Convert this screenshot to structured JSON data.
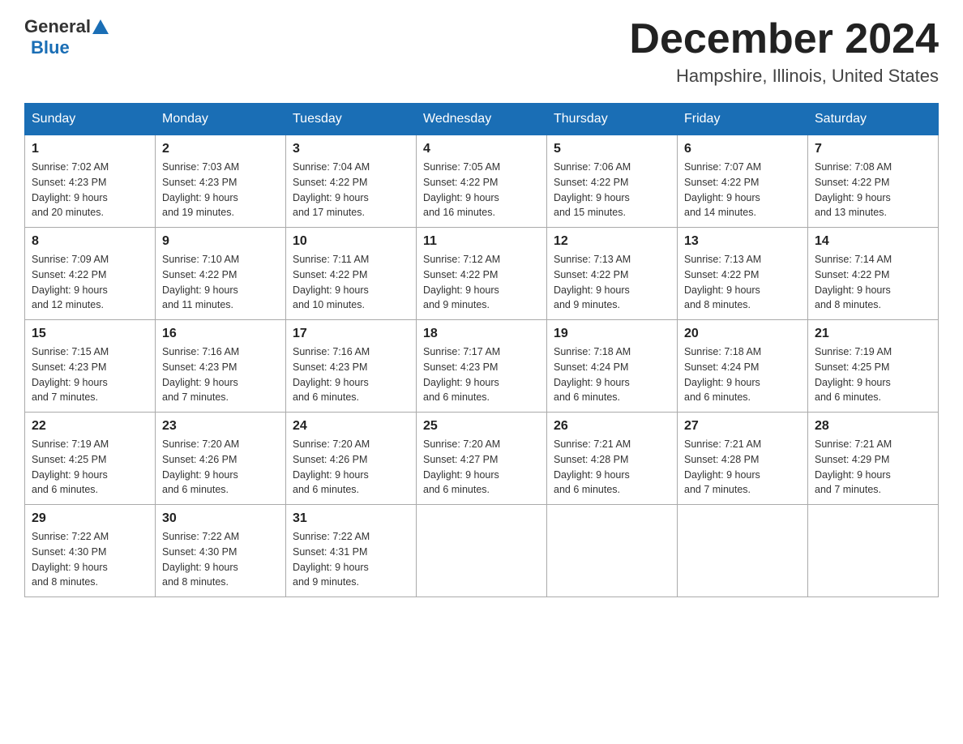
{
  "header": {
    "logo": {
      "general": "General",
      "blue": "Blue"
    },
    "title": "December 2024",
    "location": "Hampshire, Illinois, United States"
  },
  "calendar": {
    "days_of_week": [
      "Sunday",
      "Monday",
      "Tuesday",
      "Wednesday",
      "Thursday",
      "Friday",
      "Saturday"
    ],
    "weeks": [
      [
        {
          "day": "1",
          "sunrise": "7:02 AM",
          "sunset": "4:23 PM",
          "daylight": "9 hours and 20 minutes."
        },
        {
          "day": "2",
          "sunrise": "7:03 AM",
          "sunset": "4:23 PM",
          "daylight": "9 hours and 19 minutes."
        },
        {
          "day": "3",
          "sunrise": "7:04 AM",
          "sunset": "4:22 PM",
          "daylight": "9 hours and 17 minutes."
        },
        {
          "day": "4",
          "sunrise": "7:05 AM",
          "sunset": "4:22 PM",
          "daylight": "9 hours and 16 minutes."
        },
        {
          "day": "5",
          "sunrise": "7:06 AM",
          "sunset": "4:22 PM",
          "daylight": "9 hours and 15 minutes."
        },
        {
          "day": "6",
          "sunrise": "7:07 AM",
          "sunset": "4:22 PM",
          "daylight": "9 hours and 14 minutes."
        },
        {
          "day": "7",
          "sunrise": "7:08 AM",
          "sunset": "4:22 PM",
          "daylight": "9 hours and 13 minutes."
        }
      ],
      [
        {
          "day": "8",
          "sunrise": "7:09 AM",
          "sunset": "4:22 PM",
          "daylight": "9 hours and 12 minutes."
        },
        {
          "day": "9",
          "sunrise": "7:10 AM",
          "sunset": "4:22 PM",
          "daylight": "9 hours and 11 minutes."
        },
        {
          "day": "10",
          "sunrise": "7:11 AM",
          "sunset": "4:22 PM",
          "daylight": "9 hours and 10 minutes."
        },
        {
          "day": "11",
          "sunrise": "7:12 AM",
          "sunset": "4:22 PM",
          "daylight": "9 hours and 9 minutes."
        },
        {
          "day": "12",
          "sunrise": "7:13 AM",
          "sunset": "4:22 PM",
          "daylight": "9 hours and 9 minutes."
        },
        {
          "day": "13",
          "sunrise": "7:13 AM",
          "sunset": "4:22 PM",
          "daylight": "9 hours and 8 minutes."
        },
        {
          "day": "14",
          "sunrise": "7:14 AM",
          "sunset": "4:22 PM",
          "daylight": "9 hours and 8 minutes."
        }
      ],
      [
        {
          "day": "15",
          "sunrise": "7:15 AM",
          "sunset": "4:23 PM",
          "daylight": "9 hours and 7 minutes."
        },
        {
          "day": "16",
          "sunrise": "7:16 AM",
          "sunset": "4:23 PM",
          "daylight": "9 hours and 7 minutes."
        },
        {
          "day": "17",
          "sunrise": "7:16 AM",
          "sunset": "4:23 PM",
          "daylight": "9 hours and 6 minutes."
        },
        {
          "day": "18",
          "sunrise": "7:17 AM",
          "sunset": "4:23 PM",
          "daylight": "9 hours and 6 minutes."
        },
        {
          "day": "19",
          "sunrise": "7:18 AM",
          "sunset": "4:24 PM",
          "daylight": "9 hours and 6 minutes."
        },
        {
          "day": "20",
          "sunrise": "7:18 AM",
          "sunset": "4:24 PM",
          "daylight": "9 hours and 6 minutes."
        },
        {
          "day": "21",
          "sunrise": "7:19 AM",
          "sunset": "4:25 PM",
          "daylight": "9 hours and 6 minutes."
        }
      ],
      [
        {
          "day": "22",
          "sunrise": "7:19 AM",
          "sunset": "4:25 PM",
          "daylight": "9 hours and 6 minutes."
        },
        {
          "day": "23",
          "sunrise": "7:20 AM",
          "sunset": "4:26 PM",
          "daylight": "9 hours and 6 minutes."
        },
        {
          "day": "24",
          "sunrise": "7:20 AM",
          "sunset": "4:26 PM",
          "daylight": "9 hours and 6 minutes."
        },
        {
          "day": "25",
          "sunrise": "7:20 AM",
          "sunset": "4:27 PM",
          "daylight": "9 hours and 6 minutes."
        },
        {
          "day": "26",
          "sunrise": "7:21 AM",
          "sunset": "4:28 PM",
          "daylight": "9 hours and 6 minutes."
        },
        {
          "day": "27",
          "sunrise": "7:21 AM",
          "sunset": "4:28 PM",
          "daylight": "9 hours and 7 minutes."
        },
        {
          "day": "28",
          "sunrise": "7:21 AM",
          "sunset": "4:29 PM",
          "daylight": "9 hours and 7 minutes."
        }
      ],
      [
        {
          "day": "29",
          "sunrise": "7:22 AM",
          "sunset": "4:30 PM",
          "daylight": "9 hours and 8 minutes."
        },
        {
          "day": "30",
          "sunrise": "7:22 AM",
          "sunset": "4:30 PM",
          "daylight": "9 hours and 8 minutes."
        },
        {
          "day": "31",
          "sunrise": "7:22 AM",
          "sunset": "4:31 PM",
          "daylight": "9 hours and 9 minutes."
        },
        null,
        null,
        null,
        null
      ]
    ]
  }
}
